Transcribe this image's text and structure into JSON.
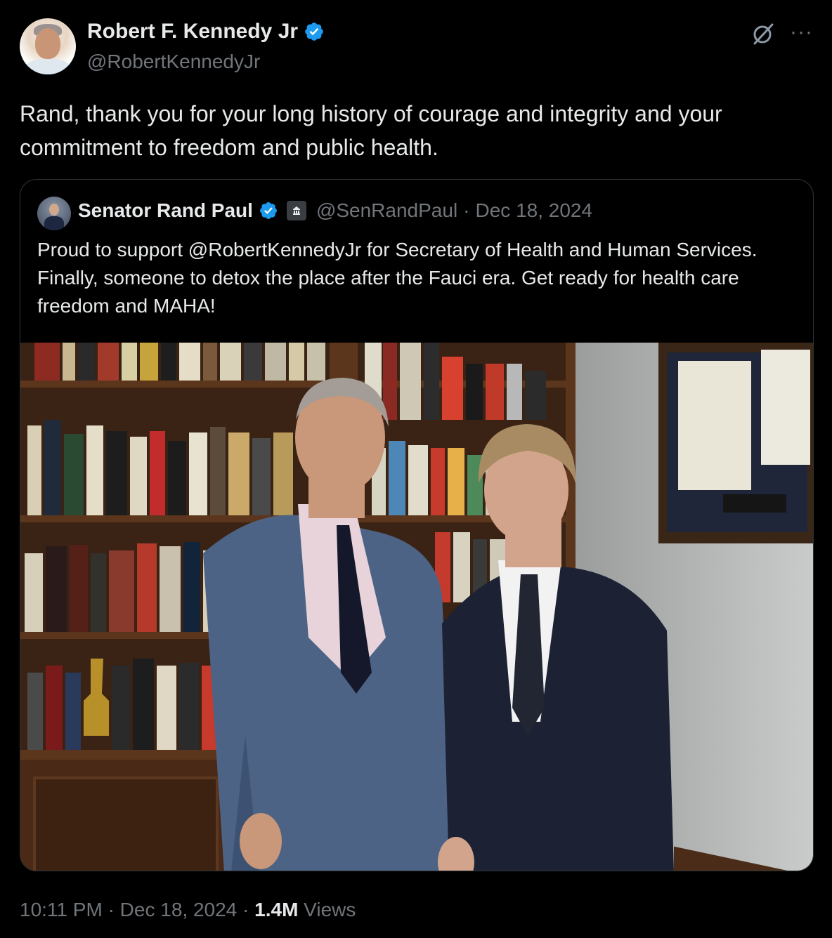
{
  "author": {
    "name": "Robert F. Kennedy Jr",
    "handle": "@RobertKennedyJr",
    "verified": true
  },
  "tweet": {
    "text": "Rand, thank you for your long history of courage and integrity and your commitment to freedom and public health."
  },
  "quoted_tweet": {
    "name": "Senator Rand Paul",
    "handle": "@SenRandPaul",
    "separator": "·",
    "date": "Dec 18, 2024",
    "verified": true,
    "text": "Proud to support @RobertKennedyJr for Secretary of Health and Human Services. Finally, someone to detox the place after the Fauci era. Get ready for health care freedom and MAHA!"
  },
  "meta": {
    "time": "10:11 PM",
    "sep1": "·",
    "date": "Dec 18, 2024",
    "sep2": "·",
    "views_count": "1.4M",
    "views_label": "Views"
  },
  "icons": {
    "verified": "verified-badge-icon",
    "grok": "grok-icon",
    "more": "more-icon",
    "government": "government-building-icon"
  },
  "colors": {
    "background": "#000000",
    "text_primary": "#e7e9ea",
    "text_secondary": "#71767b",
    "verified_blue": "#1d9bf0",
    "border": "#2f3336"
  }
}
